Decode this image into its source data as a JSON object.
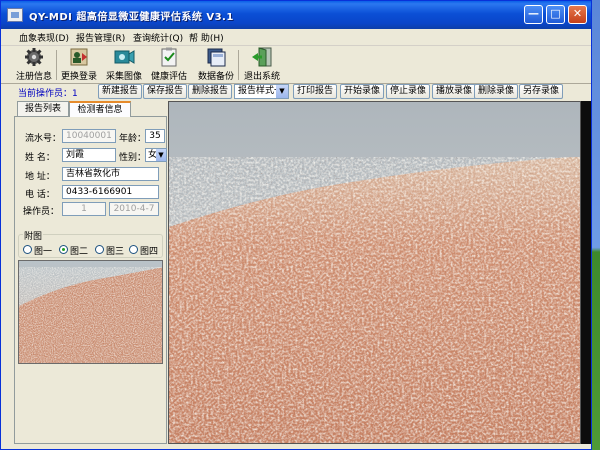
{
  "window": {
    "title": "QY-MDI 超高倍显微亚健康评估系统 V3.1",
    "min_glyph": "—",
    "max_glyph": "□",
    "close_glyph": "✕"
  },
  "menu": [
    {
      "label": "血象表现(D)"
    },
    {
      "label": "报告管理(R)"
    },
    {
      "label": "查询统计(Q)"
    },
    {
      "label": "帮 助(H)"
    }
  ],
  "toolbar": [
    {
      "label": "注册信息",
      "icon": "gear-icon"
    },
    {
      "label": "更换登录",
      "icon": "user-switch-icon"
    },
    {
      "label": "采集图像",
      "icon": "camera-icon"
    },
    {
      "label": "健康评估",
      "icon": "clipboard-check-icon"
    },
    {
      "label": "数据备份",
      "icon": "database-backup-icon"
    },
    {
      "label": "退出系统",
      "icon": "exit-door-icon"
    }
  ],
  "actionbar": {
    "operator_label": "当前操作员：1",
    "buttons": [
      "新建报告",
      "保存报告",
      "删除报告"
    ],
    "style_select": "报告样式一",
    "buttons2": [
      "打印报告",
      "开始录像",
      "停止录像",
      "播放录像",
      "删除录像",
      "另存录像"
    ]
  },
  "tabs": [
    {
      "label": "报告列表"
    },
    {
      "label": "检测者信息"
    }
  ],
  "form": {
    "serial_label": "流水号：",
    "serial_value": "10040001",
    "age_label": "年龄：",
    "age_value": "35",
    "name_label": "姓  名：",
    "name_value": "刘霞",
    "gender_label": "性别：",
    "gender_value": "女",
    "address_label": "地  址：",
    "address_value": "吉林省敦化市",
    "phone_label": "电  话：",
    "phone_value": "0433-6166901",
    "operator_label": "操作员：",
    "operator_value": "1",
    "date_value": "2010-4-7"
  },
  "attachments": {
    "title": "附图",
    "options": [
      {
        "label": "图一",
        "checked": false
      },
      {
        "label": "图二",
        "checked": true
      },
      {
        "label": "图三",
        "checked": false
      },
      {
        "label": "图四",
        "checked": false
      }
    ]
  },
  "colors": {
    "titlebar": "#0a4fd6",
    "window_bg": "#ece9d8",
    "tab_accent": "#e68b2c",
    "operator_text": "#0000c0"
  }
}
